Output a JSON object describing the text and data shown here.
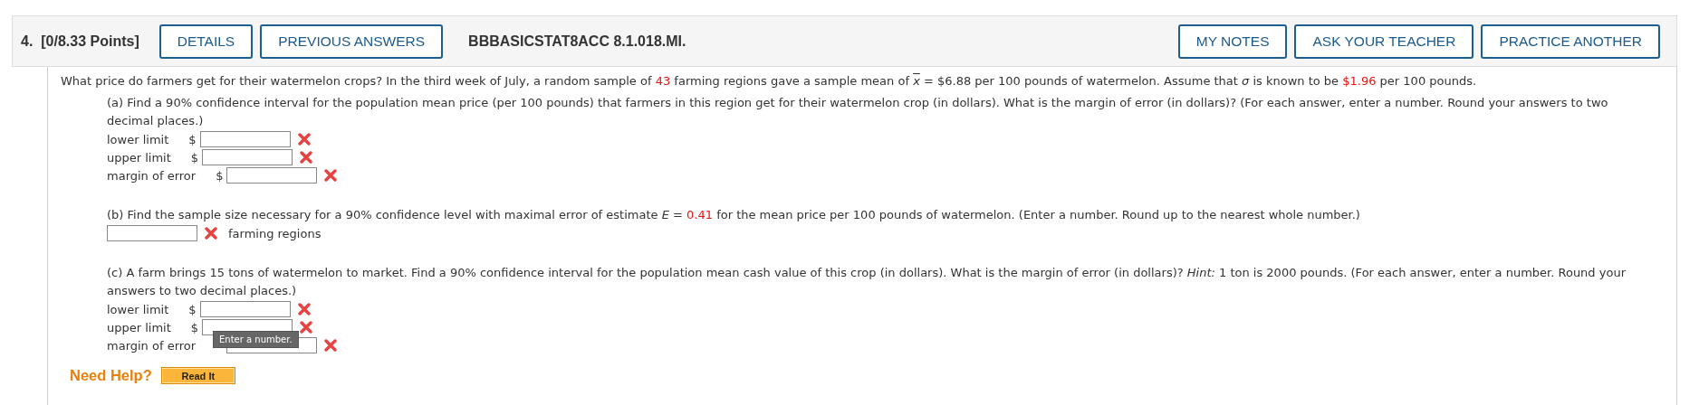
{
  "header": {
    "number": "4.",
    "points": "[0/8.33 Points]",
    "left_buttons": [
      {
        "label": "DETAILS"
      },
      {
        "label": "PREVIOUS ANSWERS"
      }
    ],
    "code": "BBBASICSTAT8ACC 8.1.018.MI.",
    "right_buttons": [
      {
        "label": "MY NOTES"
      },
      {
        "label": "ASK YOUR TEACHER"
      },
      {
        "label": "PRACTICE ANOTHER"
      }
    ]
  },
  "intro": [
    {
      "kind": "plain",
      "t": "What price do farmers get for their watermelon crops? In the third week of July, a random sample of "
    },
    {
      "kind": "red",
      "t": "43"
    },
    {
      "kind": "plain",
      "t": " farming regions gave a sample mean of "
    },
    {
      "kind": "xbar",
      "t": "x"
    },
    {
      "kind": "plain",
      "t": " = $6.88 per 100 pounds of watermelon. Assume that *σ* is known to be "
    },
    {
      "kind": "red",
      "t": "$1.96"
    },
    {
      "kind": "plain",
      "t": " per 100 pounds."
    }
  ],
  "parts": [
    {
      "text": [
        {
          "kind": "plain",
          "t": "(a) Find a 90% confidence interval for the population mean price (per 100 pounds) that farmers in this region get for their watermelon crop (in dollars). What is the margin of error (in dollars)? (For each answer, enter a number. Round your answers to two decimal places.)"
        }
      ],
      "answers": [
        {
          "kind": "labeled",
          "label": "lower limit",
          "prefix": "$",
          "correct": false
        },
        {
          "kind": "labeled",
          "label": "upper limit",
          "prefix": "$",
          "correct": false
        },
        {
          "kind": "labeled",
          "label": "margin of error",
          "prefix": "$",
          "correct": false
        }
      ]
    },
    {
      "text": [
        {
          "kind": "plain",
          "t": "(b) Find the sample size necessary for a 90% confidence level with maximal error of estimate *E* = "
        },
        {
          "kind": "red",
          "t": "0.41"
        },
        {
          "kind": "plain",
          "t": " for the mean price per 100 pounds of watermelon. (Enter a number. Round up to the nearest whole number.)"
        }
      ],
      "answers": [
        {
          "kind": "unit",
          "unit": "farming regions",
          "correct": false
        }
      ]
    },
    {
      "text": [
        {
          "kind": "plain",
          "t": "(c) A farm brings 15 tons of watermelon to market. Find a 90% confidence interval for the population mean cash value of this crop (in dollars). What is the margin of error (in dollars)? *Hint:* 1 ton is 2000 pounds. (For each answer, enter a number. Round your answers to two decimal places.)"
        }
      ],
      "answers": [
        {
          "kind": "labeled",
          "label": "lower limit",
          "prefix": "$",
          "correct": false
        },
        {
          "kind": "labeled",
          "label": "upper limit",
          "prefix": "$",
          "correct": false,
          "tooltip": "Enter a number."
        },
        {
          "kind": "labeled",
          "label": "margin of error",
          "correct": false
        }
      ]
    }
  ],
  "help": {
    "label": "Need Help?",
    "button": "Read It"
  }
}
